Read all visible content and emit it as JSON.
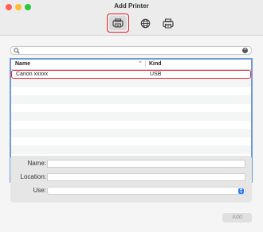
{
  "window": {
    "title": "Add Printer"
  },
  "toolbar": {
    "default_icon": "printer-icon",
    "ip_icon": "globe-icon",
    "windows_icon": "windows-printer-icon",
    "selected_outline_color": "#e0202a"
  },
  "search": {
    "value": "",
    "placeholder": ""
  },
  "table": {
    "columns": [
      "Name",
      "Kind"
    ],
    "rows": [
      {
        "name": "Canon xxxxx",
        "kind": "USB",
        "selected": true
      }
    ],
    "border_color": "#6f9ad8"
  },
  "form": {
    "name_label": "Name:",
    "location_label": "Location:",
    "use_label": "Use:",
    "name_value": "",
    "location_value": "",
    "use_value": ""
  },
  "footer": {
    "add_label": "Add"
  }
}
